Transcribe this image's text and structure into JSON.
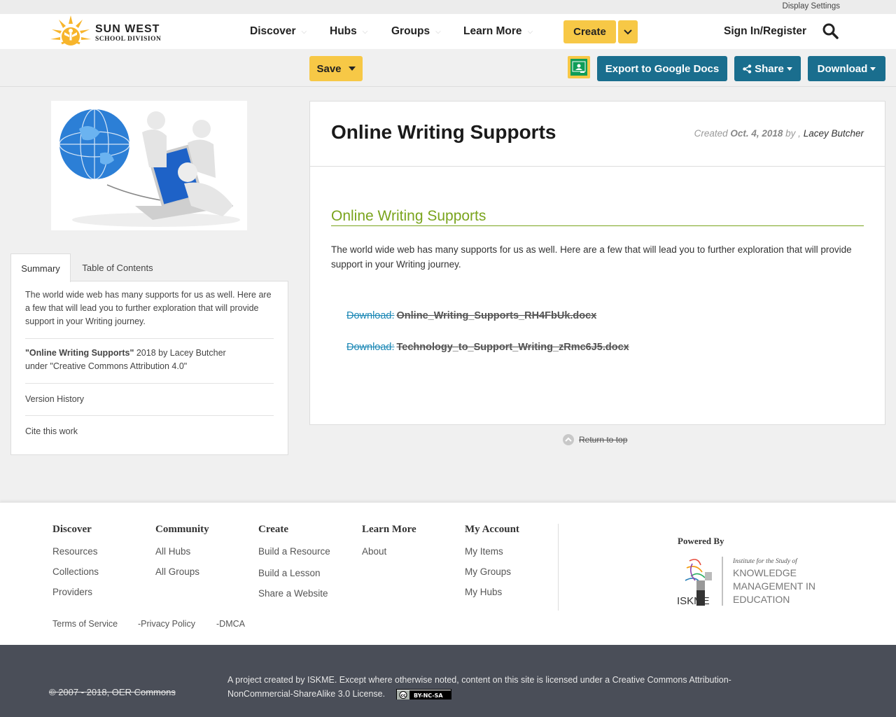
{
  "util_bar": {
    "display_settings": "Display Settings"
  },
  "brand": {
    "line1": "SUN WEST",
    "line2": "SCHOOL DIVISION"
  },
  "nav": {
    "items": [
      {
        "label": "Discover"
      },
      {
        "label": "Hubs"
      },
      {
        "label": "Groups"
      },
      {
        "label": "Learn More"
      }
    ],
    "create_label": "Create",
    "signin_label": "Sign In/Register"
  },
  "toolbar": {
    "save_label": "Save",
    "export_label": "Export to Google Docs",
    "share_label": "Share",
    "download_label": "Download"
  },
  "sidebar": {
    "tabs": [
      "Summary",
      "Table of Contents"
    ],
    "summary_text": "The world wide web has many supports for us as well. Here are a few that will lead you to further exploration that will provide support in your Writing journey.",
    "attribution_title": "\"Online Writing Supports\"",
    "attribution_rest": " 2018 by Lacey Butcher",
    "attribution_license": "under \"Creative Commons Attribution 4.0\"",
    "version_history": "Version History",
    "cite": "Cite this work"
  },
  "resource": {
    "title": "Online Writing Supports",
    "created_prefix": "Created ",
    "created_date": "Oct. 4, 2018",
    "created_by": " by , ",
    "author": "Lacey Butcher",
    "section_heading": "Online Writing Supports",
    "paragraph": "The world wide web has many supports for us as well. Here are a few that will lead you to further exploration that will provide support in your Writing journey.",
    "downloads": [
      {
        "label": "Download:",
        "file": "Online_Writing_Supports_RH4FbUk.docx"
      },
      {
        "label": "Download:",
        "file": "Technology_to_Support_Writing_zRmc6J5.docx"
      }
    ],
    "return_top": "Return to top"
  },
  "footer": {
    "columns": [
      {
        "heading": "Discover",
        "links": [
          "Resources",
          "Collections",
          "Providers"
        ]
      },
      {
        "heading": "Community",
        "links": [
          "All Hubs",
          "All Groups"
        ]
      },
      {
        "heading": "Create",
        "links": [
          "Build a Resource",
          "Build a Lesson",
          "Share a Website"
        ]
      },
      {
        "heading": "Learn More",
        "links": [
          "About"
        ]
      },
      {
        "heading": "My Account",
        "links": [
          "My Items",
          "My Groups",
          "My Hubs"
        ]
      }
    ],
    "powered_by": "Powered By",
    "iskme_tagline_1": "Institute for the Study of",
    "iskme_tagline_2": "KNOWLEDGE",
    "iskme_tagline_3": "MANAGEMENT IN",
    "iskme_tagline_4": "EDUCATION",
    "iskme_abbrev": "ISKME",
    "legal": [
      "Terms of Service",
      "-Privacy Policy",
      "-DMCA"
    ],
    "copyright": "© 2007 - 2018, OER Commons",
    "license_text": "A project created by ISKME. Except where otherwise noted, content on this site is licensed under a Creative Commons Attribution-NonCommercial-ShareAlike 3.0 License.",
    "cc_badge": "BY-NC-SA"
  },
  "colors": {
    "accent_yellow": "#f7c846",
    "button_teal": "#1a6e8e",
    "heading_green": "#7aa41d",
    "link_blue": "#1a87b5",
    "footer_dark": "#4a4e58"
  }
}
